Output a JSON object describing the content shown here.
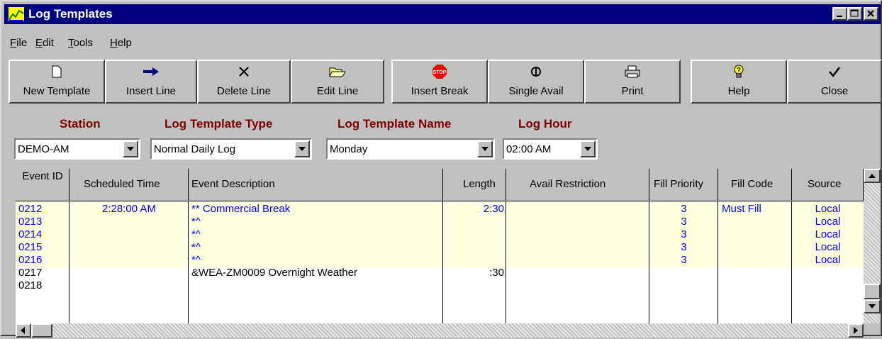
{
  "window": {
    "title": "Log Templates"
  },
  "menu": [
    {
      "key": "F",
      "rest": "ile"
    },
    {
      "key": "E",
      "rest": "dit"
    },
    {
      "key": "T",
      "rest": "ools"
    },
    {
      "key": "H",
      "rest": "elp"
    }
  ],
  "toolbar": [
    {
      "label": "New Template",
      "icon": "new-document-icon"
    },
    {
      "label": "Insert Line",
      "icon": "arrow-right-icon"
    },
    {
      "label": "Delete Line",
      "icon": "x-delete-icon"
    },
    {
      "label": "Edit Line",
      "icon": "open-folder-icon"
    },
    {
      "label": "Insert Break",
      "icon": "stop-sign-icon",
      "icon_text": "STOP"
    },
    {
      "label": "Single Avail",
      "icon": "single-avail-icon"
    },
    {
      "label": "Print",
      "icon": "printer-icon"
    },
    {
      "label": "Help",
      "icon": "help-bulb-icon"
    },
    {
      "label": "Close",
      "icon": "checkmark-icon"
    }
  ],
  "filters": {
    "station": {
      "label": "Station",
      "value": "DEMO-AM"
    },
    "type": {
      "label": "Log Template Type",
      "value": "Normal Daily Log"
    },
    "name": {
      "label": "Log Template Name",
      "value": "Monday"
    },
    "hour": {
      "label": "Log Hour",
      "value": "02:00 AM"
    }
  },
  "table": {
    "columns": [
      "Event ID",
      "Scheduled Time",
      "Event Description",
      "Length",
      "Avail Restriction",
      "Fill Priority",
      "Fill Code",
      "Source"
    ],
    "rows": [
      {
        "id": "0212",
        "time": "2:28:00 AM",
        "desc": "** Commercial Break",
        "length": "2:30",
        "avail": "",
        "priority": "3",
        "fill": "Must Fill",
        "source": "Local",
        "style": "break"
      },
      {
        "id": "0213",
        "time": "",
        "desc": "*^",
        "length": "",
        "avail": "",
        "priority": "3",
        "fill": "",
        "source": "Local",
        "style": "break"
      },
      {
        "id": "0214",
        "time": "",
        "desc": "*^",
        "length": "",
        "avail": "",
        "priority": "3",
        "fill": "",
        "source": "Local",
        "style": "break"
      },
      {
        "id": "0215",
        "time": "",
        "desc": "*^",
        "length": "",
        "avail": "",
        "priority": "3",
        "fill": "",
        "source": "Local",
        "style": "break"
      },
      {
        "id": "0216",
        "time": "",
        "desc": "*^",
        "length": "",
        "avail": "",
        "priority": "3",
        "fill": "",
        "source": "Local",
        "style": "break"
      },
      {
        "id": "0217",
        "time": "",
        "desc": "&WEA-ZM0009  Overnight Weather",
        "length": ":30",
        "avail": "",
        "priority": "",
        "fill": "",
        "source": "",
        "style": "normal"
      },
      {
        "id": "0218",
        "time": "",
        "desc": "",
        "length": "",
        "avail": "",
        "priority": "",
        "fill": "",
        "source": "",
        "style": "normal"
      }
    ]
  },
  "colors": {
    "break_bg": "#ffffe1",
    "break_text": "#0000ff",
    "label_red": "#800000",
    "titlebar": "#000080"
  }
}
